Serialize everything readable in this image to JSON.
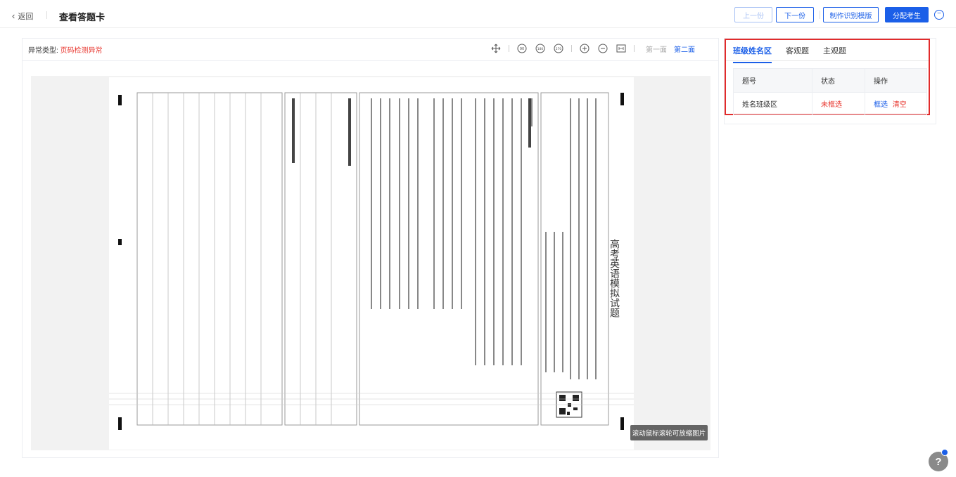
{
  "header": {
    "back_label": "返回",
    "title": "查看答题卡",
    "prev_label": "上一份",
    "next_label": "下一份",
    "template_label": "制作识别模版",
    "assign_label": "分配考生",
    "more_icon": "more-circle-icon"
  },
  "left": {
    "anomaly_label": "异常类型:",
    "anomaly_value": "页码检测异常",
    "toolbar": {
      "icons": [
        "move-icon",
        "rotate-90-icon",
        "rotate-180-icon",
        "rotate-270-icon",
        "zoom-in-icon",
        "zoom-out-icon",
        "fit-icon"
      ],
      "side_one": "第一面",
      "side_two": "第二面"
    },
    "sheet_title": "高考英语模拟试题",
    "zoom_tip": "滚动鼠标滚轮可放缩图片"
  },
  "right": {
    "tabs": [
      "班级姓名区",
      "客观题",
      "主观题"
    ],
    "columns": [
      "题号",
      "状态",
      "操作"
    ],
    "rows": [
      {
        "name": "姓名班级区",
        "status": "未框选",
        "action_select": "框选",
        "action_clear": "清空"
      }
    ]
  },
  "help_label": "?"
}
